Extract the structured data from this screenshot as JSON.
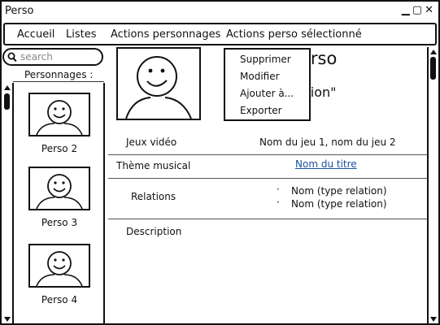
{
  "window": {
    "title": "Perso"
  },
  "window_controls": {
    "minimize": "▁",
    "maximize": "▢",
    "close": "✕"
  },
  "menu": {
    "items": [
      "Accueil",
      "Listes",
      "Actions personnages",
      "Actions perso sélectionné"
    ]
  },
  "search": {
    "placeholder": "search"
  },
  "list": {
    "header": "Personnages :",
    "items": [
      {
        "label": "Perso 2"
      },
      {
        "label": "Perso 3"
      },
      {
        "label": "Perso 4"
      }
    ]
  },
  "detail": {
    "name_visible": "erso",
    "quote_visible": "itation\"",
    "rows": [
      {
        "label": "Jeux vidéo",
        "value": "Nom du jeu 1, nom du jeu 2"
      },
      {
        "label": "Thème musical",
        "value": "Nom du titre"
      },
      {
        "label": "Relations",
        "values": [
          "Nom (type relation)",
          "Nom (type relation)"
        ]
      },
      {
        "label": "Description"
      }
    ]
  },
  "dropdown": {
    "items": [
      "Supprimer",
      "Modifier",
      "Ajouter à...",
      "Exporter"
    ]
  },
  "icons": {
    "search": "search-icon",
    "avatar": "smiley-face-icon"
  }
}
